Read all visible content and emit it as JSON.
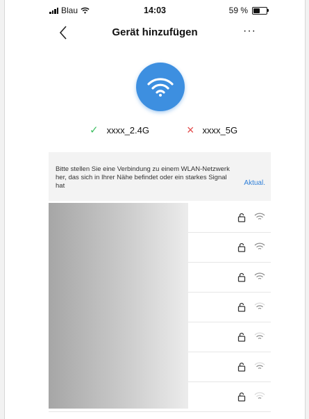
{
  "status_bar": {
    "carrier": "Blau",
    "time": "14:03",
    "battery": "59 %",
    "battery_level": 0.59
  },
  "header": {
    "title": "Gerät hinzufügen",
    "more": "···"
  },
  "bands": {
    "supported": "xxxx_2.4G",
    "unsupported": "xxxx_5G"
  },
  "instruction": {
    "text": "Bitte stellen Sie eine Verbindung zu einem WLAN-Netzwerk her, das sich in Ihrer Nähe befindet oder ein starkes Signal hat",
    "refresh": "Aktual."
  },
  "networks": [
    {
      "locked": true,
      "signal": 3
    },
    {
      "locked": true,
      "signal": 3
    },
    {
      "locked": true,
      "signal": 3
    },
    {
      "locked": true,
      "signal": 2
    },
    {
      "locked": true,
      "signal": 2
    },
    {
      "locked": true,
      "signal": 2
    },
    {
      "locked": true,
      "signal": 1
    }
  ],
  "colors": {
    "accent": "#3d8fe0",
    "ok": "#3fbf62",
    "error": "#e24b4b",
    "link": "#2f7fd8"
  }
}
